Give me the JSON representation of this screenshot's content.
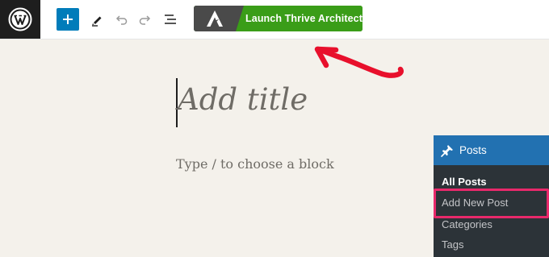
{
  "toolbar": {
    "wp_logo_icon": "wordpress-logo-icon",
    "add_block_icon": "plus-icon",
    "tools_icon": "pencil-icon",
    "undo_icon": "undo-icon",
    "redo_icon": "redo-icon",
    "list_view_icon": "list-view-icon",
    "thrive_button_label": "Launch Thrive Architect",
    "thrive_logo_icon": "thrive-architect-logo-icon"
  },
  "editor": {
    "title_placeholder": "Add title",
    "block_placeholder": "Type / to choose a block"
  },
  "admin_menu": {
    "section_label": "Posts",
    "section_icon": "pushpin-icon",
    "items": [
      {
        "label": "All Posts",
        "current": true
      },
      {
        "label": "Add New Post",
        "highlighted": true
      },
      {
        "label": "Categories"
      },
      {
        "label": "Tags"
      }
    ]
  },
  "colors": {
    "canvas": "#f4f1eb",
    "wp_blue": "#007cba",
    "thrive_green": "#3a9d18",
    "admin_menu_bg": "#2c3338",
    "admin_menu_active": "#2271b1",
    "annotation_red": "#e8102c",
    "highlight_pink": "#e8296b"
  }
}
